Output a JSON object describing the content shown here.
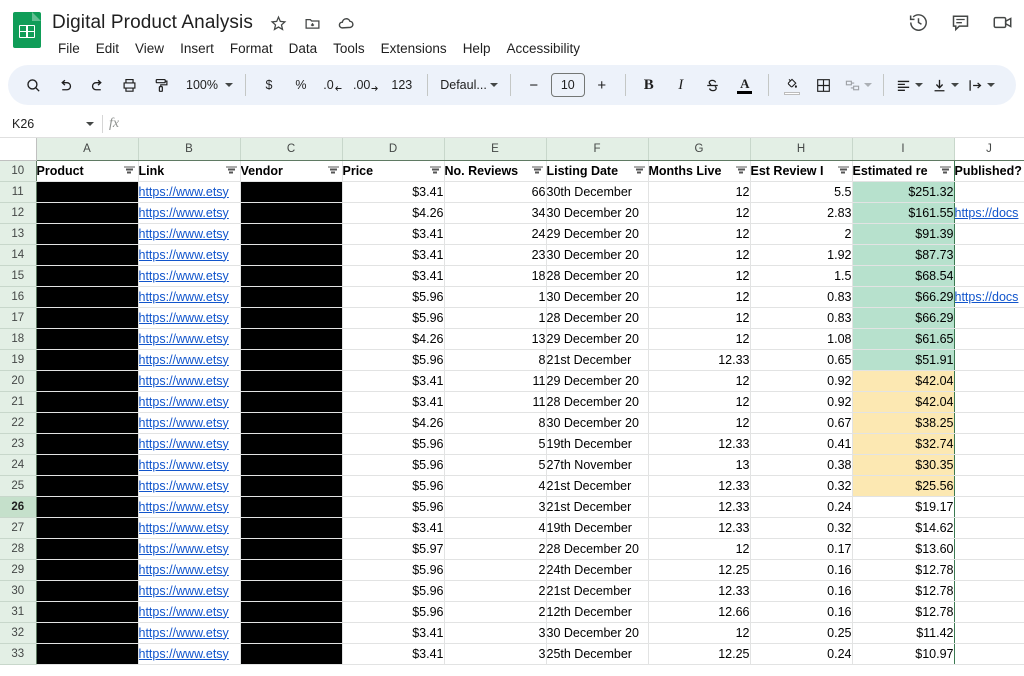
{
  "app": {
    "doc_title": "Digital Product Analysis",
    "title_icons": [
      "star-icon",
      "move-to-folder-icon",
      "cloud-saved-icon"
    ],
    "menus": [
      "File",
      "Edit",
      "View",
      "Insert",
      "Format",
      "Data",
      "Tools",
      "Extensions",
      "Help",
      "Accessibility"
    ],
    "top_right_icons": [
      "version-history-icon",
      "comment-icon",
      "video-call-icon"
    ]
  },
  "toolbar": {
    "search_icon": "search-icon",
    "undo_icon": "undo-icon",
    "redo_icon": "redo-icon",
    "print_icon": "print-icon",
    "paint_format_icon": "paint-format-icon",
    "zoom_value": "100%",
    "currency_label": "$",
    "percent_label": "%",
    "decrease_decimal_label": ".0",
    "increase_decimal_label": ".00",
    "more_formats_label": "123",
    "font_family": "Defaul...",
    "font_decrease": "−",
    "font_size": "10",
    "font_increase": "+",
    "bold_label": "B",
    "italic_label": "I",
    "strikethrough_icon": "strikethrough-icon",
    "text_color_label": "A",
    "fill_color_icon": "fill-color-icon",
    "borders_icon": "borders-icon",
    "merge_cells_icon": "merge-cells-icon",
    "horizontal_align_icon": "horizontal-align-icon",
    "vertical_align_icon": "vertical-align-icon",
    "text_wrap_icon": "text-wrap-icon"
  },
  "formula_bar": {
    "name_box": "K26",
    "fx_label": "fx",
    "formula_value": ""
  },
  "grid": {
    "column_letters": [
      "A",
      "B",
      "C",
      "D",
      "E",
      "F",
      "G",
      "H",
      "I",
      "J"
    ],
    "selected_cell": "K26",
    "selected_row": "26",
    "header_row_number": "10",
    "headers": [
      "Product",
      "Link",
      "Vendor",
      "Price",
      "No. Reviews",
      "Listing Date",
      "Months Live",
      "Est Review I",
      "Estimated re",
      "Published?"
    ],
    "link_text_b": "https://www.etsy",
    "link_text_j": "https://docs",
    "colors": {
      "high_band": "#b7e1cd",
      "mid_band": "#fce8b2",
      "header_green": "#e3efe5",
      "link_blue": "#1155cc",
      "accent_green": "#0f9d58"
    },
    "rows": [
      {
        "n": "11",
        "product": "",
        "link": "https://www.etsy",
        "vendor": "",
        "price": "$3.41",
        "reviews": "66",
        "listing_date": "30th December",
        "months_live": "12",
        "est_review": "5.5",
        "estimated_rev": "$251.32",
        "published": "",
        "band": "green"
      },
      {
        "n": "12",
        "product": "",
        "link": "https://www.etsy",
        "vendor": "",
        "price": "$4.26",
        "reviews": "34",
        "listing_date": "30 December 20",
        "months_live": "12",
        "est_review": "2.83",
        "estimated_rev": "$161.55",
        "published": "https://docs",
        "band": "green"
      },
      {
        "n": "13",
        "product": "",
        "link": "https://www.etsy",
        "vendor": "",
        "price": "$3.41",
        "reviews": "24",
        "listing_date": "29 December 20",
        "months_live": "12",
        "est_review": "2",
        "estimated_rev": "$91.39",
        "published": "",
        "band": "green"
      },
      {
        "n": "14",
        "product": "",
        "link": "https://www.etsy",
        "vendor": "",
        "price": "$3.41",
        "reviews": "23",
        "listing_date": "30 December 20",
        "months_live": "12",
        "est_review": "1.92",
        "estimated_rev": "$87.73",
        "published": "",
        "band": "green"
      },
      {
        "n": "15",
        "product": "",
        "link": "https://www.etsy",
        "vendor": "",
        "price": "$3.41",
        "reviews": "18",
        "listing_date": "28 December 20",
        "months_live": "12",
        "est_review": "1.5",
        "estimated_rev": "$68.54",
        "published": "",
        "band": "green"
      },
      {
        "n": "16",
        "product": "",
        "link": "https://www.etsy",
        "vendor": "",
        "price": "$5.96",
        "reviews": "1",
        "listing_date": "30 December 20",
        "months_live": "12",
        "est_review": "0.83",
        "estimated_rev": "$66.29",
        "published": "https://docs",
        "band": "green"
      },
      {
        "n": "17",
        "product": "",
        "link": "https://www.etsy",
        "vendor": "",
        "price": "$5.96",
        "reviews": "1",
        "listing_date": "28 December 20",
        "months_live": "12",
        "est_review": "0.83",
        "estimated_rev": "$66.29",
        "published": "",
        "band": "green"
      },
      {
        "n": "18",
        "product": "",
        "link": "https://www.etsy",
        "vendor": "",
        "price": "$4.26",
        "reviews": "13",
        "listing_date": "29 December 20",
        "months_live": "12",
        "est_review": "1.08",
        "estimated_rev": "$61.65",
        "published": "",
        "band": "green"
      },
      {
        "n": "19",
        "product": "",
        "link": "https://www.etsy",
        "vendor": "",
        "price": "$5.96",
        "reviews": "8",
        "listing_date": "21st December",
        "months_live": "12.33",
        "est_review": "0.65",
        "estimated_rev": "$51.91",
        "published": "",
        "band": "green"
      },
      {
        "n": "20",
        "product": "",
        "link": "https://www.etsy",
        "vendor": "",
        "price": "$3.41",
        "reviews": "11",
        "listing_date": "29 December 20",
        "months_live": "12",
        "est_review": "0.92",
        "estimated_rev": "$42.04",
        "published": "",
        "band": "amber"
      },
      {
        "n": "21",
        "product": "",
        "link": "https://www.etsy",
        "vendor": "",
        "price": "$3.41",
        "reviews": "11",
        "listing_date": "28 December 20",
        "months_live": "12",
        "est_review": "0.92",
        "estimated_rev": "$42.04",
        "published": "",
        "band": "amber"
      },
      {
        "n": "22",
        "product": "",
        "link": "https://www.etsy",
        "vendor": "",
        "price": "$4.26",
        "reviews": "8",
        "listing_date": "30 December 20",
        "months_live": "12",
        "est_review": "0.67",
        "estimated_rev": "$38.25",
        "published": "",
        "band": "amber"
      },
      {
        "n": "23",
        "product": "",
        "link": "https://www.etsy",
        "vendor": "",
        "price": "$5.96",
        "reviews": "5",
        "listing_date": "19th December",
        "months_live": "12.33",
        "est_review": "0.41",
        "estimated_rev": "$32.74",
        "published": "",
        "band": "amber"
      },
      {
        "n": "24",
        "product": "",
        "link": "https://www.etsy",
        "vendor": "",
        "price": "$5.96",
        "reviews": "5",
        "listing_date": "27th November",
        "months_live": "13",
        "est_review": "0.38",
        "estimated_rev": "$30.35",
        "published": "",
        "band": "amber"
      },
      {
        "n": "25",
        "product": "",
        "link": "https://www.etsy",
        "vendor": "",
        "price": "$5.96",
        "reviews": "4",
        "listing_date": "21st December",
        "months_live": "12.33",
        "est_review": "0.32",
        "estimated_rev": "$25.56",
        "published": "",
        "band": "amber"
      },
      {
        "n": "26",
        "product": "",
        "link": "https://www.etsy",
        "vendor": "",
        "price": "$5.96",
        "reviews": "3",
        "listing_date": "21st December",
        "months_live": "12.33",
        "est_review": "0.24",
        "estimated_rev": "$19.17",
        "published": "",
        "band": "none"
      },
      {
        "n": "27",
        "product": "",
        "link": "https://www.etsy",
        "vendor": "",
        "price": "$3.41",
        "reviews": "4",
        "listing_date": "19th December",
        "months_live": "12.33",
        "est_review": "0.32",
        "estimated_rev": "$14.62",
        "published": "",
        "band": "none"
      },
      {
        "n": "28",
        "product": "",
        "link": "https://www.etsy",
        "vendor": "",
        "price": "$5.97",
        "reviews": "2",
        "listing_date": "28 December 20",
        "months_live": "12",
        "est_review": "0.17",
        "estimated_rev": "$13.60",
        "published": "",
        "band": "none"
      },
      {
        "n": "29",
        "product": "",
        "link": "https://www.etsy",
        "vendor": "",
        "price": "$5.96",
        "reviews": "2",
        "listing_date": "24th December",
        "months_live": "12.25",
        "est_review": "0.16",
        "estimated_rev": "$12.78",
        "published": "",
        "band": "none"
      },
      {
        "n": "30",
        "product": "",
        "link": "https://www.etsy",
        "vendor": "",
        "price": "$5.96",
        "reviews": "2",
        "listing_date": "21st December",
        "months_live": "12.33",
        "est_review": "0.16",
        "estimated_rev": "$12.78",
        "published": "",
        "band": "none"
      },
      {
        "n": "31",
        "product": "",
        "link": "https://www.etsy",
        "vendor": "",
        "price": "$5.96",
        "reviews": "2",
        "listing_date": "12th December",
        "months_live": "12.66",
        "est_review": "0.16",
        "estimated_rev": "$12.78",
        "published": "",
        "band": "none"
      },
      {
        "n": "32",
        "product": "",
        "link": "https://www.etsy",
        "vendor": "",
        "price": "$3.41",
        "reviews": "3",
        "listing_date": "30 December 20",
        "months_live": "12",
        "est_review": "0.25",
        "estimated_rev": "$11.42",
        "published": "",
        "band": "none"
      },
      {
        "n": "33",
        "product": "",
        "link": "https://www.etsy",
        "vendor": "",
        "price": "$3.41",
        "reviews": "3",
        "listing_date": "25th December ",
        "months_live": "12.25",
        "est_review": "0.24",
        "estimated_rev": "$10.97",
        "published": "",
        "band": "none"
      }
    ]
  }
}
